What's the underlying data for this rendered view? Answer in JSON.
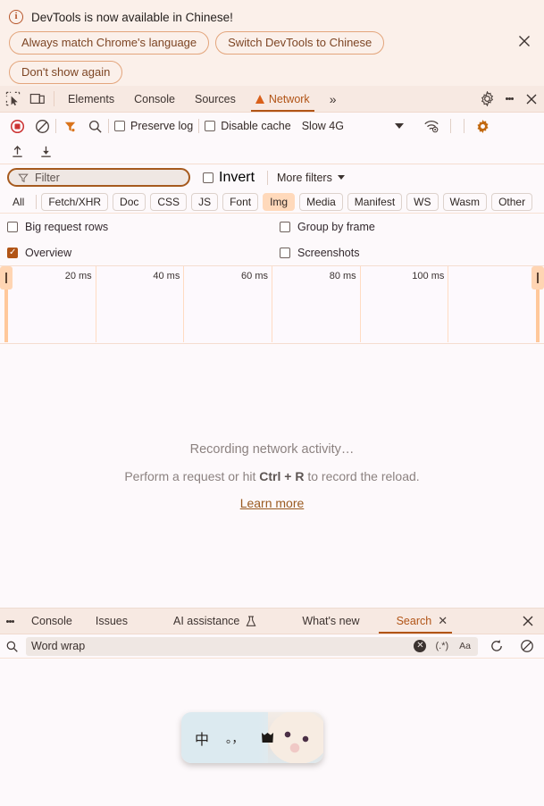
{
  "notification": {
    "icon": "info-icon",
    "title": "DevTools is now available in Chinese!",
    "buttons": [
      {
        "label": "Always match Chrome's language"
      },
      {
        "label": "Switch DevTools to Chinese"
      },
      {
        "label": "Don't show again"
      }
    ],
    "close_icon": "close-icon"
  },
  "main_tabs": {
    "left_icons": [
      {
        "name": "inspect-element-icon"
      },
      {
        "name": "device-toolbar-icon"
      }
    ],
    "tabs": [
      {
        "label": "Elements",
        "active": false
      },
      {
        "label": "Console",
        "active": false
      },
      {
        "label": "Sources",
        "active": false
      },
      {
        "label": "Network",
        "active": true,
        "warning": true
      }
    ],
    "overflow_label": "»",
    "right_icons": [
      {
        "name": "settings-gear-icon"
      },
      {
        "name": "more-options-kebab-icon"
      },
      {
        "name": "close-devtools-icon"
      }
    ]
  },
  "network_toolbar": {
    "record_icon": "record-stop-icon",
    "clear_icon": "clear-network-log-icon",
    "filter_icon": "filter-funnel-icon",
    "search_icon": "search-icon",
    "preserve_log": {
      "label": "Preserve log",
      "checked": false
    },
    "disable_cache": {
      "label": "Disable cache",
      "checked": false
    },
    "throttling": {
      "value": "Slow 4G"
    },
    "network_conditions_icon": "wifi-conditions-icon",
    "settings_icon": "network-settings-gear-icon",
    "import_icon": "import-har-icon",
    "export_icon": "export-har-icon"
  },
  "filter_row": {
    "filter_placeholder": "Filter",
    "filter_icon": "filter-funnel-icon",
    "invert": {
      "label": "Invert",
      "checked": false
    },
    "more_filters": {
      "label": "More filters"
    }
  },
  "resource_type_chips": [
    {
      "label": "All",
      "active": false
    },
    {
      "label": "Fetch/XHR",
      "active": false
    },
    {
      "label": "Doc",
      "active": false
    },
    {
      "label": "CSS",
      "active": false
    },
    {
      "label": "JS",
      "active": false
    },
    {
      "label": "Font",
      "active": false
    },
    {
      "label": "Img",
      "active": true
    },
    {
      "label": "Media",
      "active": false
    },
    {
      "label": "Manifest",
      "active": false
    },
    {
      "label": "WS",
      "active": false
    },
    {
      "label": "Wasm",
      "active": false
    },
    {
      "label": "Other",
      "active": false
    }
  ],
  "options": {
    "big_request_rows": {
      "label": "Big request rows",
      "checked": false
    },
    "group_by_frame": {
      "label": "Group by frame",
      "checked": false
    },
    "overview": {
      "label": "Overview",
      "checked": true
    },
    "screenshots": {
      "label": "Screenshots",
      "checked": false
    }
  },
  "chart_data": {
    "type": "timeline",
    "title": "Network overview timeline",
    "unit": "ms",
    "tick_labels": [
      "20 ms",
      "40 ms",
      "60 ms",
      "80 ms",
      "100 ms"
    ],
    "tick_values": [
      20,
      40,
      60,
      80,
      100
    ],
    "axis_range": [
      0,
      120
    ],
    "series": [],
    "grid": true,
    "selection_handles": [
      "left",
      "right"
    ]
  },
  "empty_state": {
    "title": "Recording network activity…",
    "subtitle_prefix": "Perform a request or hit ",
    "shortcut": "Ctrl + R",
    "subtitle_suffix": " to record the reload.",
    "link": "Learn more"
  },
  "drawer": {
    "kebab_icon": "drawer-menu-icon",
    "tabs": [
      {
        "label": "Console",
        "active": false,
        "closable": false
      },
      {
        "label": "Issues",
        "active": false,
        "closable": false
      },
      {
        "label": "AI assistance",
        "active": false,
        "closable": false,
        "badge_icon": "experiment-flask-icon"
      },
      {
        "label": "What's new",
        "active": false,
        "closable": false
      },
      {
        "label": "Search",
        "active": true,
        "closable": true
      }
    ],
    "close_icon": "close-drawer-icon"
  },
  "search_bar": {
    "search_icon": "search-icon",
    "value": "Word wrap",
    "clear_icon": "clear-input-icon",
    "regex_label": "(.*)",
    "match_case_label": "Aa",
    "refresh_icon": "refresh-search-icon",
    "clear_results_icon": "clear-results-icon"
  },
  "ime_toolbar": {
    "mode_label": "中",
    "punctuation_label": "。，",
    "shape_icon": "ime-shape-icon",
    "skin_icon": "ime-cat-skin-image"
  },
  "colors": {
    "accent": "#b15416",
    "banner_bg": "#fbf0ea",
    "toolbar_bg": "#f7e9e2",
    "panel_bg": "#fdf9fb",
    "chip_active_bg": "#ffd9bb",
    "record_red": "#cc3333",
    "timeline_handle": "#ffc89b"
  }
}
